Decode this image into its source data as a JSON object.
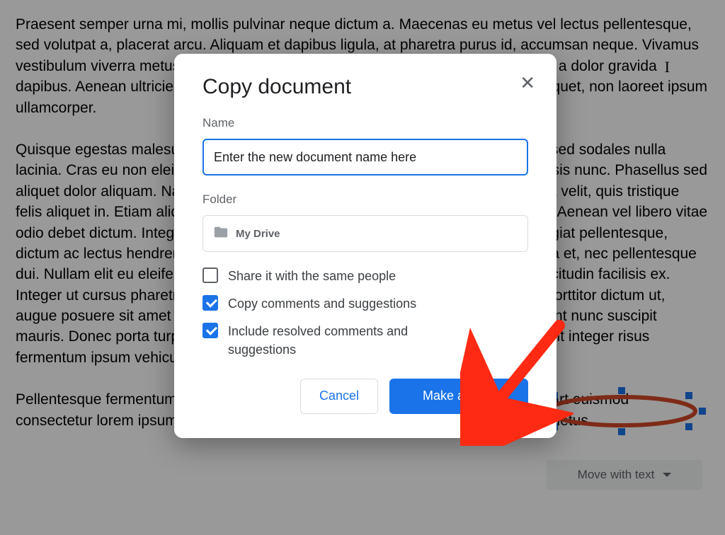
{
  "background": {
    "paragraphs": [
      "Praesent semper urna mi, mollis pulvinar neque dictum a. Maecenas eu metus vel lectus pellentesque, sed volutpat a, placerat arcu. Aliquam et dapibus ligula, at pharetra purus id, accumsan neque. Vivamus vestibulum viverra metus, eu egestas ex ornare scelerisque. Mauris sodales lacus a dolor gravida dapibus. Aenean ultricies sapien id euismod porttitor. Sed ultricies erat vel sem aliquet, non laoreet ipsum ullamcorper.",
      "Quisque egestas malesuada odio. Mauris interdum nisi. Sed ornare odio efficitur, sed sodales nulla lacinia. Cras eu non eleifend urna, et blandit arcu. Morbi facilisis est ante, eu facilisis nunc. Phasellus sed aliquet dolor aliquam. Nam vitae vehicula felis, sed posuere. Nam interdum massa velit, quis tristique felis aliquet in. Etiam aliquam elementum rhoncus incididunt auctor nec eget eros. Aenean vel libero vitae odio debet dictum. Integer maximus condimentum nunc imperdiet tincidunt. In feugiat pellentesque, dictum ac lectus hendrerit et imperdiet. Quisque facilisis erat dui, eu tincidunt ligula et, nec pellentesque dui. Nullam elit eu eleifend. Quisque mattis orci leo, ut tincidunt quis ante vel, sollicitudin facilisis ex. Integer ut cursus pharetra. Lorem ipsum dolor sit amet, tellus hendrerit eu. Nulla porttitor dictum ut, augue posuere sit amet fermentum diam. Duis dignissim convallis ligula, et tincidunt nunc suscipit mauris. Donec porta turpis a odio tincidunt pretium. Nulla consectetur adipiscing elit integer risus fermentum ipsum vehicula elementum.",
      "Pellentesque fermentum metus at magna consectetur, eu aliquam dui sodales uslart euismod consectetur lorem ipsum dolor sit amet adipiscing elit. Etiam aliquam mauris nec metus."
    ],
    "annotated_text": "suscipit mauris.",
    "move_with_text": "Move with text"
  },
  "modal": {
    "title": "Copy document",
    "name_label": "Name",
    "name_value": "Enter the new document name here",
    "folder_label": "Folder",
    "folder_value": "My Drive",
    "checkboxes": [
      {
        "label": "Share it with the same people",
        "checked": false
      },
      {
        "label": "Copy comments and suggestions",
        "checked": true
      },
      {
        "label": "Include resolved comments and suggestions",
        "checked": true
      }
    ],
    "cancel_label": "Cancel",
    "confirm_label": "Make a copy"
  },
  "colors": {
    "accent": "#1a73e8",
    "arrow": "#ff2a13"
  }
}
